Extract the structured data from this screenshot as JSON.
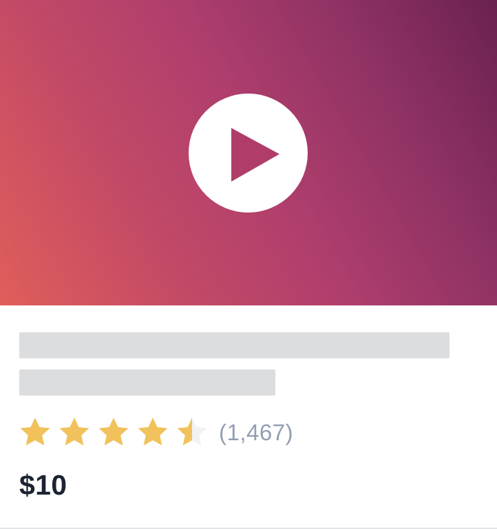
{
  "media": {
    "play_icon": "play-icon",
    "gradient_colors": [
      "#e05e5a",
      "#b13f6d",
      "#6a2150"
    ]
  },
  "rating": {
    "value": 4.5,
    "max": 5,
    "count_text": "(1,467)",
    "star_color": "#f1c25b"
  },
  "price": {
    "text": "$10"
  }
}
